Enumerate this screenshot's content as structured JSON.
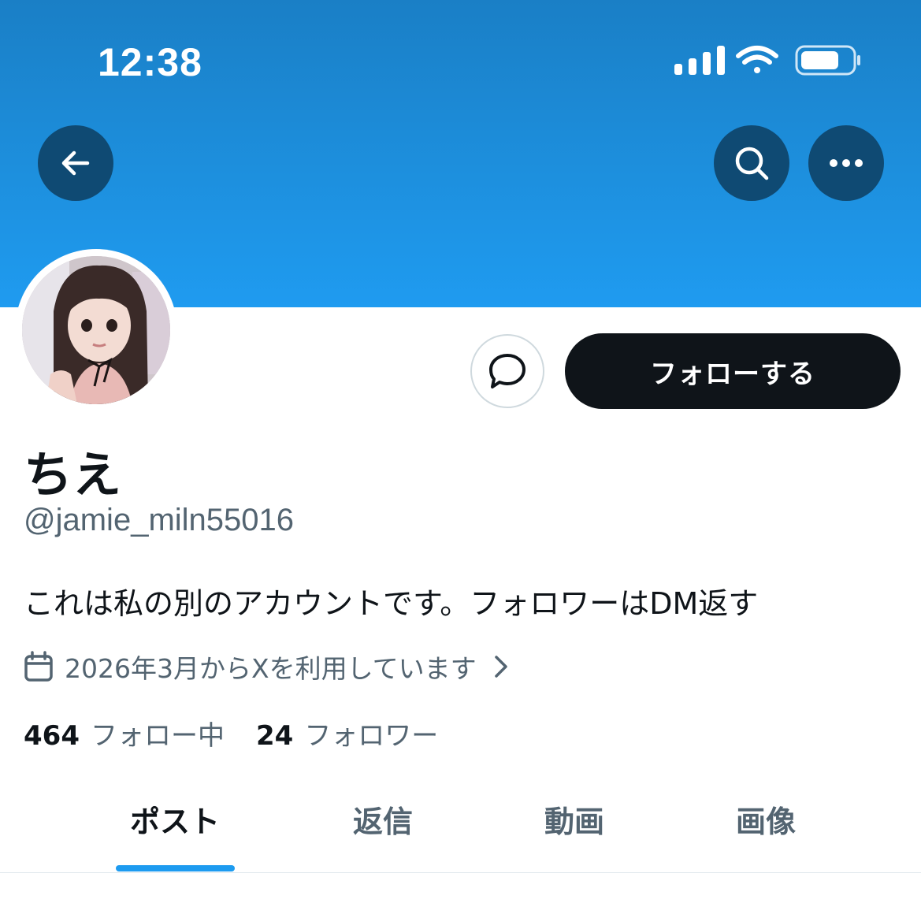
{
  "status_bar": {
    "time": "12:38",
    "icons": [
      "cellular-signal-icon",
      "wifi-icon",
      "battery-icon"
    ]
  },
  "header": {
    "back_icon": "arrow-left-icon",
    "search_icon": "search-icon",
    "more_icon": "more-horizontal-icon",
    "banner_color": "#1d8fdd"
  },
  "profile": {
    "display_name": "ちえ",
    "handle": "@jamie_miln55016",
    "bio": "これは私の別のアカウントです。フォロワーはDM返す",
    "joined": "2026年3月からXを利用しています",
    "following_count": "464",
    "following_label": "フォロー中",
    "followers_count": "24",
    "followers_label": "フォロワー"
  },
  "actions": {
    "message_icon": "message-bubble-icon",
    "follow_label": "フォローする"
  },
  "tabs": [
    {
      "label": "ポスト",
      "active": true
    },
    {
      "label": "返信",
      "active": false
    },
    {
      "label": "動画",
      "active": false
    },
    {
      "label": "画像",
      "active": false
    }
  ],
  "colors": {
    "accent": "#1d9bf0",
    "text_primary": "#0f1419",
    "text_secondary": "#536471",
    "follow_button_bg": "#0f1419"
  }
}
